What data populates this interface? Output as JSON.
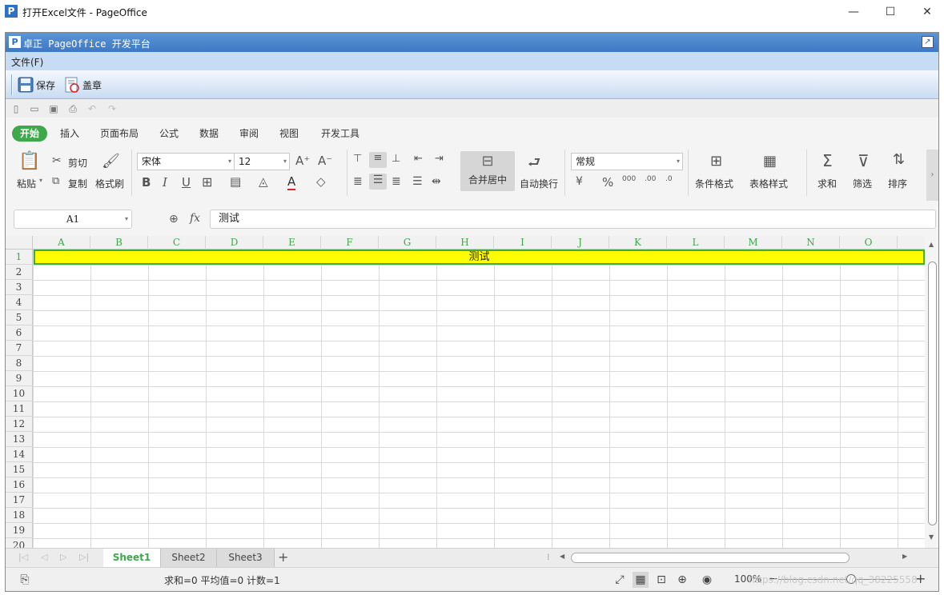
{
  "window": {
    "title": "打开Excel文件 - PageOffice",
    "icon_letter": "P",
    "minimize": "—",
    "maximize": "☐",
    "close": "✕"
  },
  "pageoffice": {
    "logo_letter": "P",
    "title": "卓正 PageOffice 开发平台"
  },
  "menu": {
    "file": "文件(F)"
  },
  "toolbar": {
    "save": "保存",
    "stamp": "盖章"
  },
  "ribbon": {
    "tabs": [
      "开始",
      "插入",
      "页面布局",
      "公式",
      "数据",
      "审阅",
      "视图",
      "开发工具"
    ],
    "active_tab": "开始",
    "clipboard": {
      "paste": "粘贴",
      "cut": "剪切",
      "copy": "复制",
      "format_painter": "格式刷"
    },
    "font": {
      "name": "宋体",
      "size": "12"
    },
    "alignment": {
      "merge_center": "合并居中",
      "wrap_text": "自动换行"
    },
    "number": {
      "format": "常规"
    },
    "styles": {
      "conditional_format": "条件格式",
      "table_style": "表格样式"
    },
    "editing": {
      "sum": "求和",
      "filter": "筛选",
      "sort": "排序"
    }
  },
  "formula_bar": {
    "cell_ref": "A1",
    "fx_label": "fx",
    "value": "测试"
  },
  "sheet": {
    "columns": [
      "A",
      "B",
      "C",
      "D",
      "E",
      "F",
      "G",
      "H",
      "I",
      "J",
      "K",
      "L",
      "M",
      "N",
      "O"
    ],
    "rows": [
      "1",
      "2",
      "3",
      "4",
      "5",
      "6",
      "7",
      "8",
      "9",
      "10",
      "11",
      "12",
      "13",
      "14",
      "15",
      "16",
      "17",
      "18",
      "19",
      "20"
    ],
    "merged_cell_text": "测试",
    "merged_fill": "#ffff00",
    "active_color": "#3fa84a"
  },
  "sheet_tabs": [
    "Sheet1",
    "Sheet2",
    "Sheet3"
  ],
  "add_sheet": "+",
  "status": {
    "summary": "求和=0  平均值=0  计数=1",
    "zoom": "100%",
    "watermark": "https://blog.csdn.net/qq_38225558"
  }
}
